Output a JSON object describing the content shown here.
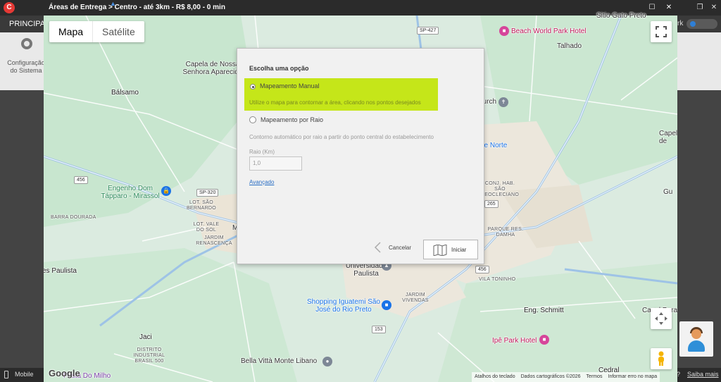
{
  "app": {
    "logo_text": "C",
    "menu_principal": "PRINCIPAL",
    "toggle_label": "rk",
    "config_label": "Configuração do Sistema",
    "status_mobile": "Mobile",
    "status_help": "?",
    "status_saiba": "Saiba mais"
  },
  "window": {
    "title": "Áreas de Entrega > Centro - até 3km - R$ 8,00 - 0 min"
  },
  "map": {
    "type_map": "Mapa",
    "type_satellite": "Satélite",
    "google": "Google",
    "footer": {
      "keyboard": "Atalhos do teclado",
      "data": "Dados cartográficos ©2026",
      "terms": "Termos",
      "report": "Informar erro no mapa"
    },
    "labels": {
      "balsamo": "Bálsamo",
      "capela": "Capela de Nossa Senhora Aparecida",
      "sp427": "SP-427",
      "beach": "Beach World Park Hotel",
      "talhado": "Talhado",
      "sitio": "Sitio Gato Preto",
      "church": "hurch",
      "norte": "de Norte",
      "engenho": "Engenho Dom Tápparo - Mirassol",
      "barra": "BARRA DOURADA",
      "sp320": "SP-320",
      "lot_sb": "LOT. SÃO BERNARDO",
      "vale": "LOT. VALE DO SOL",
      "renascenca": "JARDIM RENASCENÇA",
      "hab": "CONJ. HAB. SÃO DEOCLECIANO",
      "r456": "456",
      "r265": "265",
      "parque": "PARQUE RES. DAMHA",
      "paulista": "es Paulista",
      "univ": "Universidade Paulista",
      "vivendas": "JARDIM VIVENDAS",
      "toninho": "VILA TONINHO",
      "shopping": "Shopping Iguatemi São José do Rio Preto",
      "schmitt": "Eng. Schmitt",
      "r153": "153",
      "jaci": "Jaci",
      "distrito": "DISTRITO INDUSTRIAL BRASIL 500",
      "ipe": "Ipê Park Hotel",
      "bella": "Bella Vittà Monte Libano",
      "milho": "Festa Do Milho",
      "cedral": "Cedral",
      "capela2": "Capela de",
      "capela3": "Capel Pura",
      "gu": "Gu",
      "m": "M"
    }
  },
  "dialog": {
    "title": "Escolha uma opção",
    "option_manual": "Mapeamento Manual",
    "option_manual_desc": "Utilize o mapa para contornar a área, clicando nos pontos desejados",
    "option_radius": "Mapeamento por Raio",
    "option_radius_desc": "Contorno automático por raio a partir do ponto central do estabelecimento",
    "radius_label": "Raio (Km)",
    "radius_value": "1,0",
    "advanced": "Avançado",
    "cancel": "Cancelar",
    "start": "Iniciar"
  },
  "colors": {
    "highlight": "#c5e619",
    "link": "#2a6fc4",
    "map_green": "#cfe9d3",
    "road": "#ffffff",
    "highway": "#9ec3e6"
  }
}
